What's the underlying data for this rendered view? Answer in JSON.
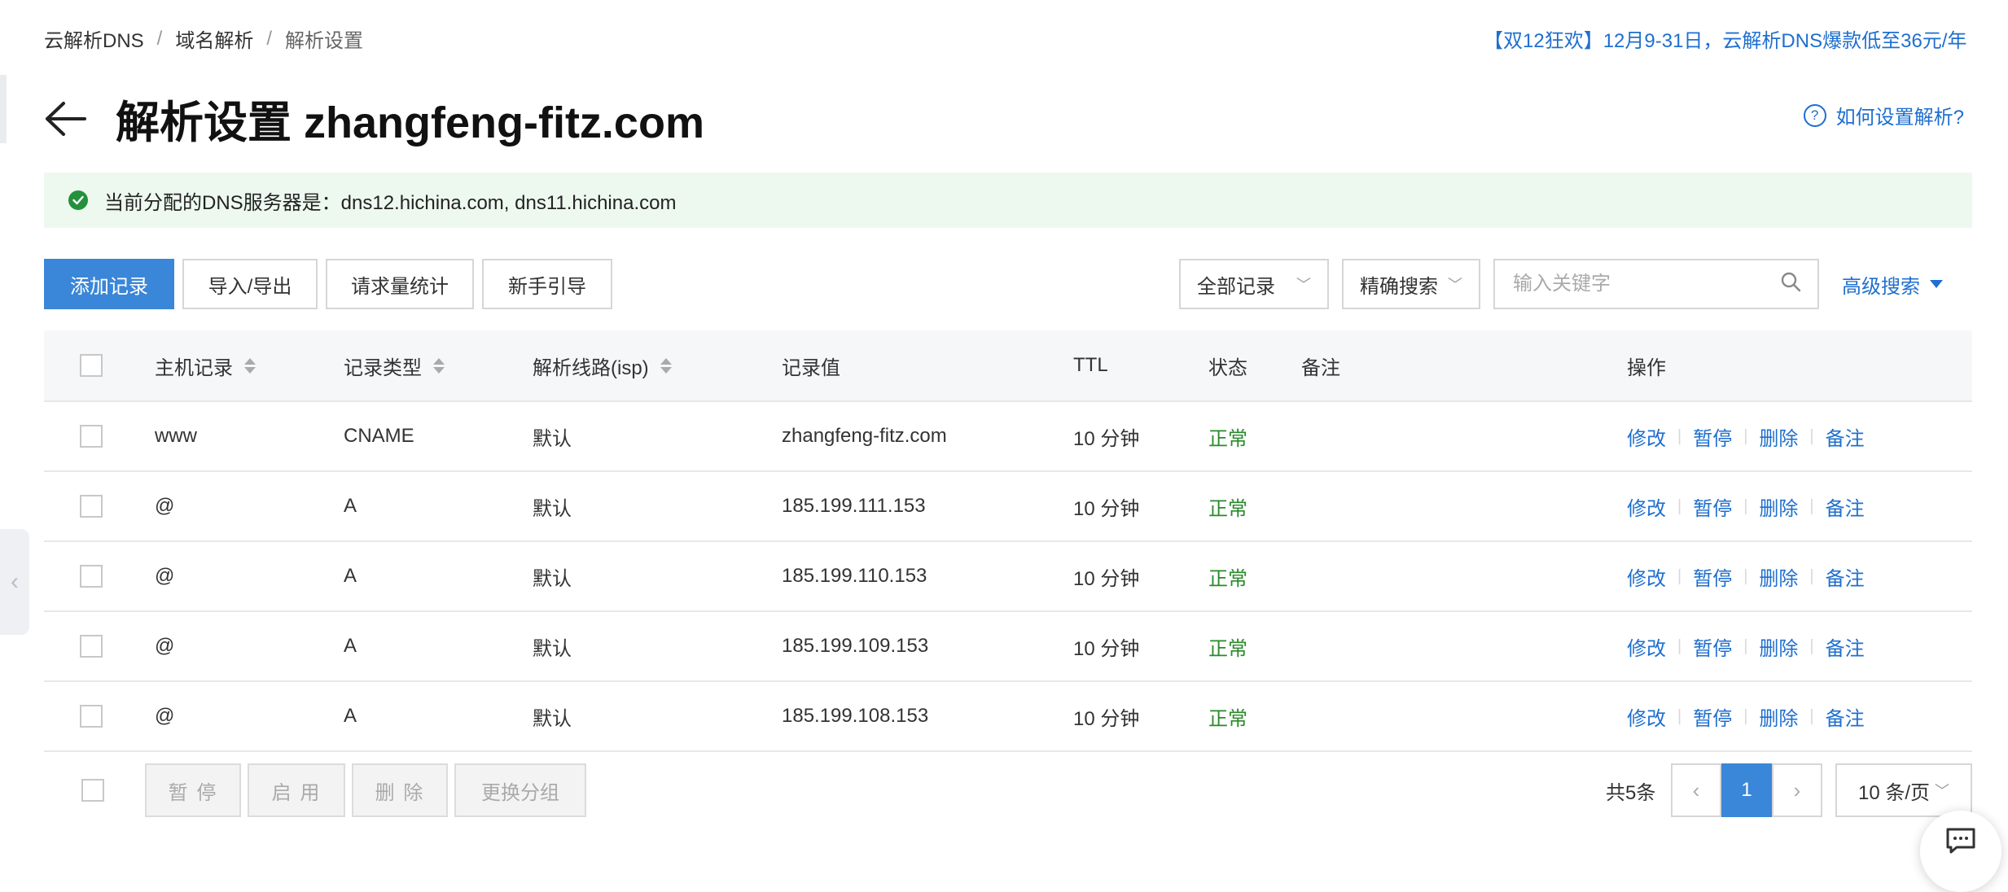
{
  "breadcrumb": {
    "items": [
      "云解析DNS",
      "域名解析"
    ],
    "separator": "/",
    "current": "解析设置"
  },
  "promo": "【双12狂欢】12月9-31日，云解析DNS爆款低至36元/年",
  "title": "解析设置 zhangfeng-fitz.com",
  "help_link": "如何设置解析?",
  "banner": "当前分配的DNS服务器是：dns12.hichina.com, dns11.hichina.com",
  "toolbar": {
    "add": "添加记录",
    "import_export": "导入/导出",
    "request_stats": "请求量统计",
    "guide": "新手引导"
  },
  "filters": {
    "record_filter": "全部记录",
    "search_mode": "精确搜索",
    "search_placeholder": "输入关键字",
    "advanced": "高级搜索"
  },
  "table": {
    "headers": {
      "host": "主机记录",
      "type": "记录类型",
      "line": "解析线路(isp)",
      "value": "记录值",
      "ttl": "TTL",
      "status": "状态",
      "remark": "备注",
      "actions": "操作"
    },
    "rows": [
      {
        "host": "www",
        "type": "CNAME",
        "line": "默认",
        "value": "zhangfeng-fitz.com",
        "ttl": "10 分钟",
        "status": "正常",
        "remark": ""
      },
      {
        "host": "@",
        "type": "A",
        "line": "默认",
        "value": "185.199.111.153",
        "ttl": "10 分钟",
        "status": "正常",
        "remark": ""
      },
      {
        "host": "@",
        "type": "A",
        "line": "默认",
        "value": "185.199.110.153",
        "ttl": "10 分钟",
        "status": "正常",
        "remark": ""
      },
      {
        "host": "@",
        "type": "A",
        "line": "默认",
        "value": "185.199.109.153",
        "ttl": "10 分钟",
        "status": "正常",
        "remark": ""
      },
      {
        "host": "@",
        "type": "A",
        "line": "默认",
        "value": "185.199.108.153",
        "ttl": "10 分钟",
        "status": "正常",
        "remark": ""
      }
    ],
    "row_actions": {
      "edit": "修改",
      "pause": "暂停",
      "delete": "删除",
      "remark": "备注"
    }
  },
  "footer": {
    "bulk": {
      "pause": "暂 停",
      "enable": "启 用",
      "delete": "删 除",
      "change_group": "更换分组"
    },
    "total": "共5条",
    "prev": "‹",
    "current_page": "1",
    "next": "›",
    "page_size": "10 条/页"
  },
  "colors": {
    "primary": "#3a86d8",
    "link": "#1f6fcf",
    "success": "#2a8a2a",
    "banner_bg": "#edf9ef"
  },
  "icons": [
    "back-arrow-icon",
    "help-icon",
    "check-circle-icon",
    "chevron-down-icon",
    "search-icon",
    "caret-down-icon",
    "sort-icon",
    "chat-icon",
    "collapse-icon"
  ]
}
